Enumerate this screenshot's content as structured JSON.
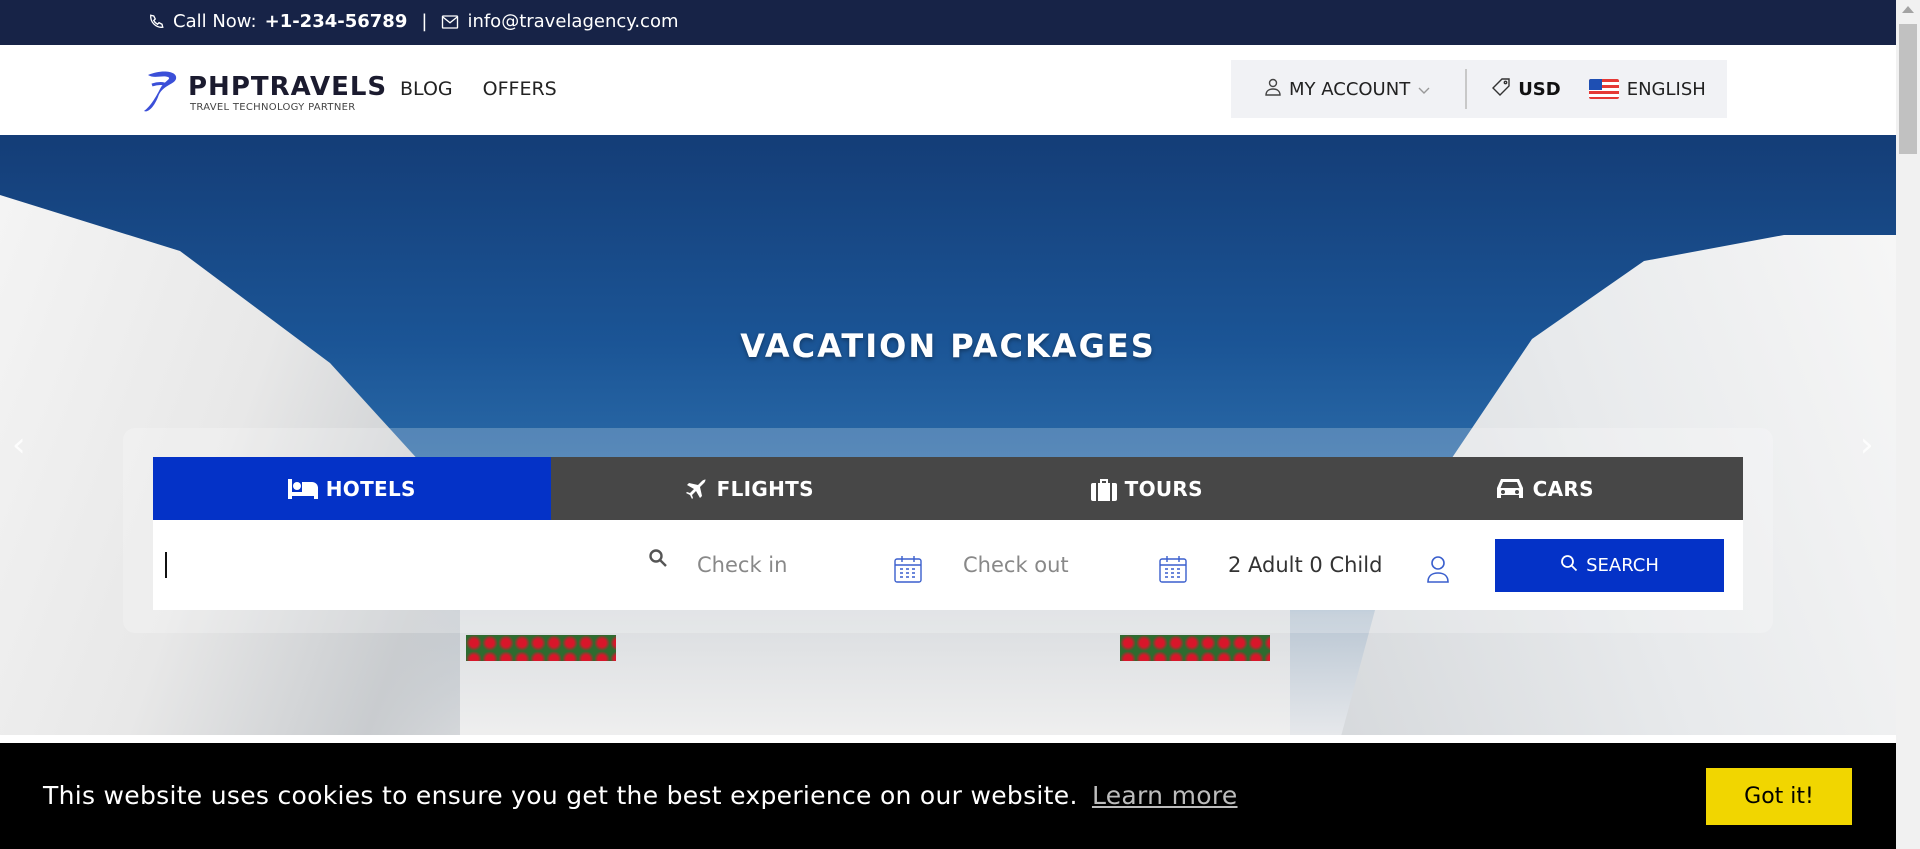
{
  "topbar": {
    "call_label": "Call Now:",
    "phone": "+1-234-56789",
    "separator": "|",
    "email": "info@travelagency.com"
  },
  "header": {
    "logo_name": "PHPTRAVELS",
    "logo_tagline": "TRAVEL TECHNOLOGY PARTNER",
    "nav": [
      "BLOG",
      "OFFERS"
    ],
    "account_label": "MY ACCOUNT",
    "currency": "USD",
    "language": "ENGLISH"
  },
  "hero": {
    "title": "VACATION PACKAGES",
    "prev_arrow": "‹",
    "next_arrow": "›"
  },
  "search": {
    "tabs": [
      {
        "label": "HOTELS",
        "icon": "bed-icon",
        "active": true
      },
      {
        "label": "FLIGHTS",
        "icon": "plane-icon",
        "active": false
      },
      {
        "label": "TOURS",
        "icon": "suitcase-icon",
        "active": false
      },
      {
        "label": "CARS",
        "icon": "car-icon",
        "active": false
      }
    ],
    "destination_value": "",
    "checkin_placeholder": "Check in",
    "checkout_placeholder": "Check out",
    "guests": "2 Adult 0 Child",
    "button_label": "SEARCH"
  },
  "cookie": {
    "message": "This website uses cookies to ensure you get the best experience on our website.",
    "learn_more": "Learn more",
    "accept": "Got it!"
  },
  "colors": {
    "topbar_bg": "#172347",
    "primary": "#0432c7",
    "tabbar_bg": "#474747",
    "cookie_accept": "#f1d600"
  }
}
